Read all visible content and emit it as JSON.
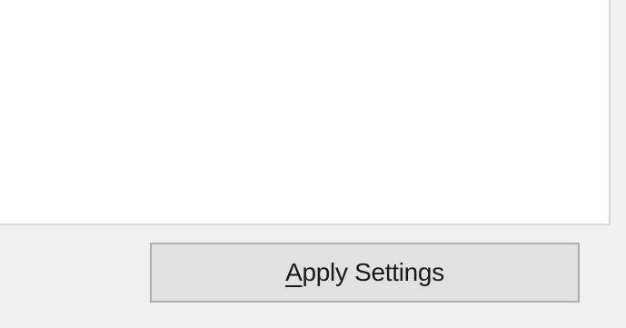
{
  "dialog": {
    "content_pane": {
      "text": ""
    },
    "apply_button": {
      "mnemonic": "A",
      "label_rest": "pply Settings"
    }
  },
  "colors": {
    "pane_background": "#ffffff",
    "dialog_background": "#f0f0f0",
    "button_background": "#e1e1e1",
    "button_border": "#adadad"
  }
}
